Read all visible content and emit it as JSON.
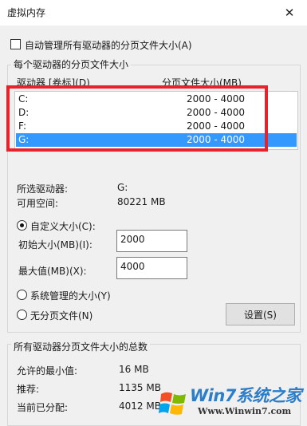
{
  "window": {
    "title": "虚拟内存",
    "close_glyph": "✕"
  },
  "auto_manage": {
    "label": "自动管理所有驱动器的分页文件大小(A)",
    "checked": false
  },
  "per_drive_group": {
    "title": "每个驱动器的分页文件大小",
    "columns": {
      "drive": "驱动器 [卷标](D)",
      "size": "分页文件大小(MB)"
    },
    "rows": [
      {
        "drive": "C:",
        "size": "2000 - 4000"
      },
      {
        "drive": "D:",
        "size": "2000 - 4000"
      },
      {
        "drive": "F:",
        "size": "2000 - 4000"
      },
      {
        "drive": "G:",
        "size": "2000 - 4000"
      }
    ],
    "selected_index": 3
  },
  "selected_info": {
    "selected_drive_label": "所选驱动器:",
    "selected_drive_value": "G:",
    "free_space_label": "可用空间:",
    "free_space_value": "80221 MB"
  },
  "size_options": {
    "custom_label": "自定义大小(C):",
    "custom_selected": true,
    "initial_label": "初始大小(MB)(I):",
    "initial_value": "2000",
    "max_label": "最大值(MB)(X):",
    "max_value": "4000",
    "system_label": "系统管理的大小(Y)",
    "none_label": "无分页文件(N)",
    "set_button": "设置(S)"
  },
  "totals_group": {
    "title": "所有驱动器分页文件大小的总数",
    "min_label": "允许的最小值:",
    "min_value": "16 MB",
    "recommended_label": "推荐:",
    "recommended_value": "1135 MB",
    "allocated_label": "当前已分配:",
    "allocated_value": "4012 MB"
  },
  "watermark": {
    "brand": "Win7系统之家",
    "url": "Www.Winwin7.com"
  },
  "colors": {
    "highlight": "#e8212b",
    "selection": "#3399ff"
  }
}
